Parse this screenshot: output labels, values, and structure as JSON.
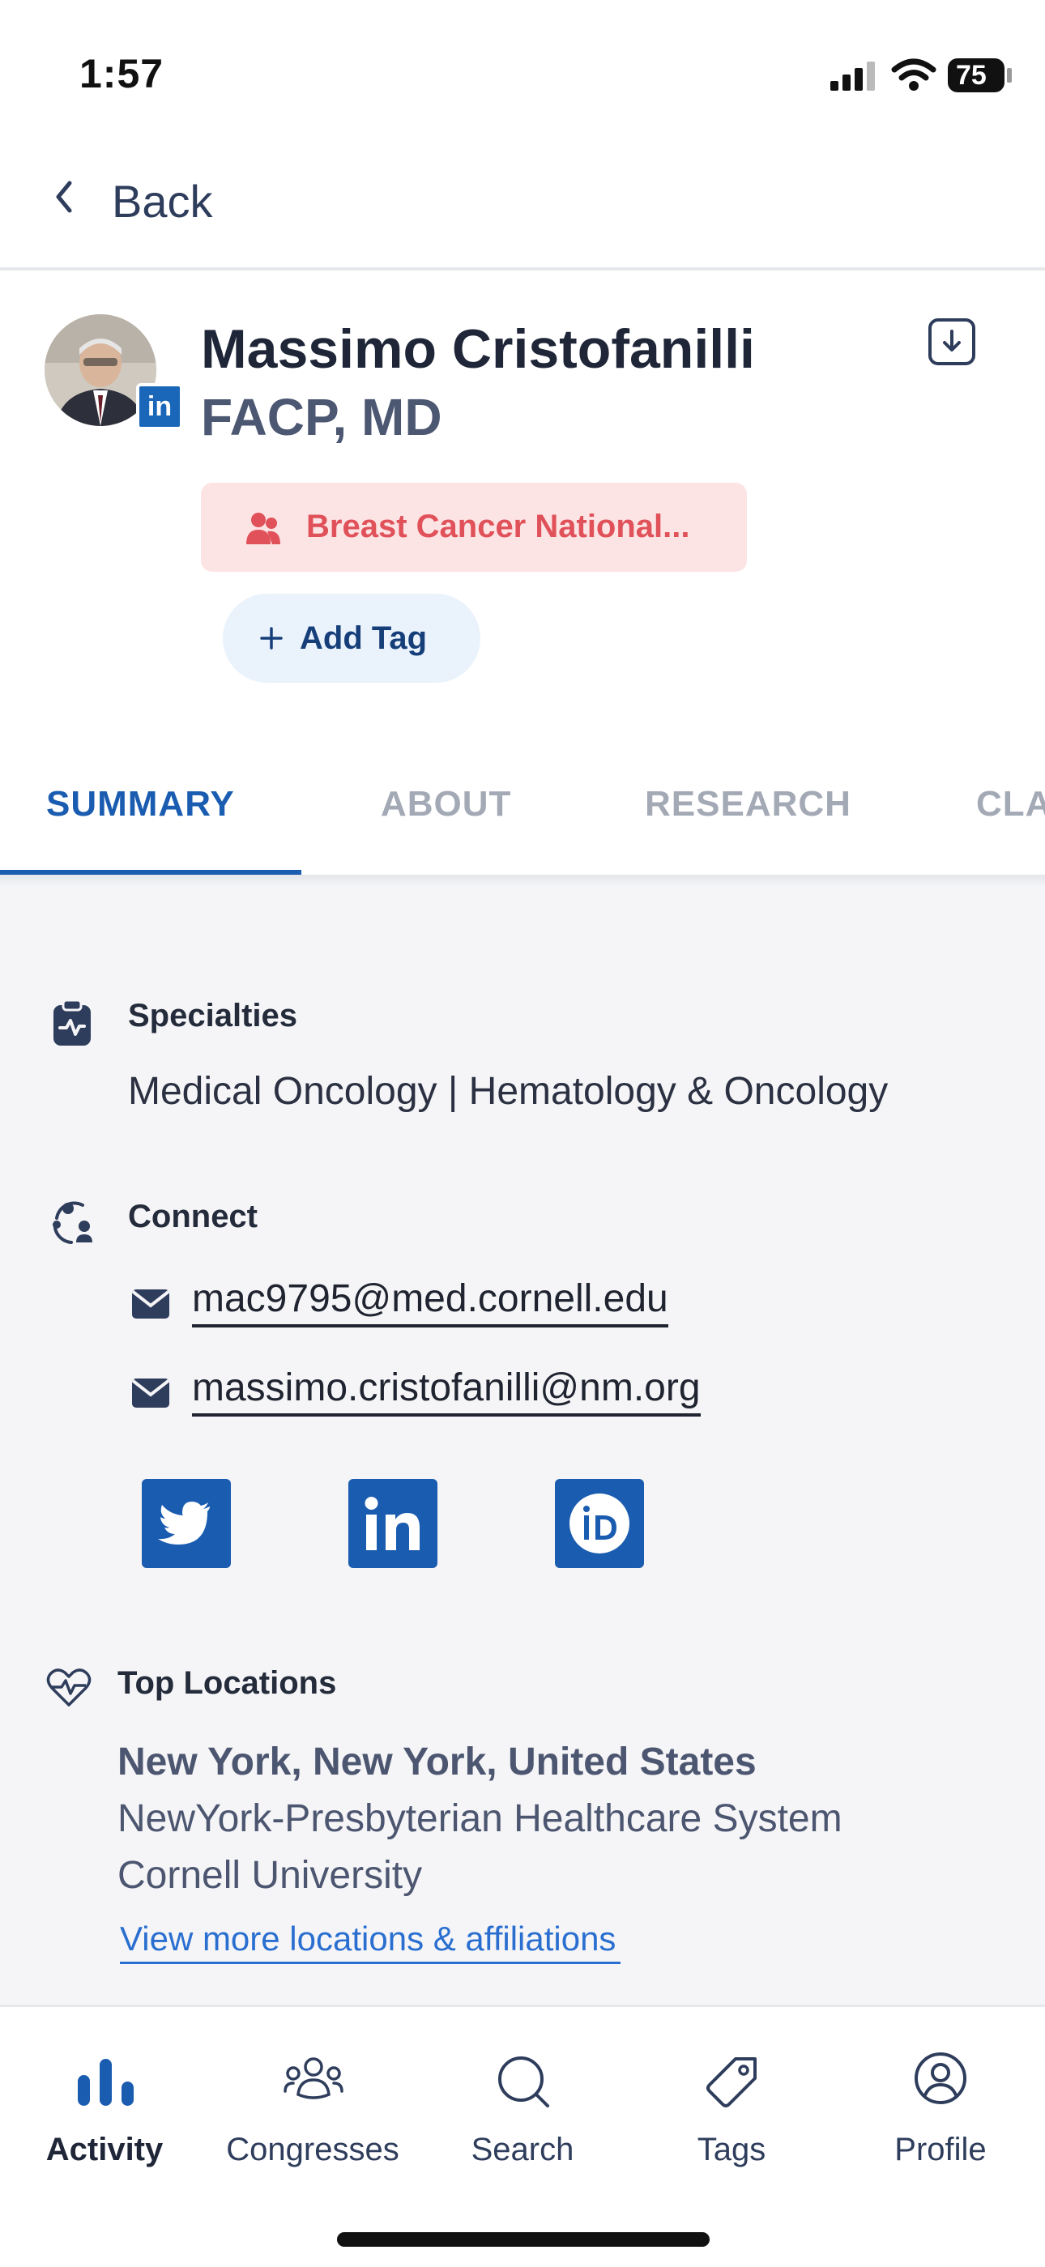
{
  "status_bar": {
    "time": "1:57",
    "battery": "75"
  },
  "header": {
    "back_label": "Back"
  },
  "profile": {
    "name": "Massimo Cristofanilli",
    "credentials": "FACP, MD",
    "org_tag": "Breast Cancer National...",
    "add_tag_label": "Add Tag"
  },
  "tabs": [
    {
      "label": "SUMMARY",
      "active": true
    },
    {
      "label": "ABOUT",
      "active": false
    },
    {
      "label": "RESEARCH",
      "active": false
    },
    {
      "label": "CLA",
      "active": false
    }
  ],
  "specialties": {
    "title": "Specialties",
    "value": "Medical Oncology | Hematology & Oncology"
  },
  "connect": {
    "title": "Connect",
    "emails": [
      "mac9795@med.cornell.edu",
      "massimo.cristofanilli@nm.org"
    ],
    "socials": [
      "twitter-icon",
      "linkedin-icon",
      "orcid-icon"
    ]
  },
  "locations": {
    "title": "Top Locations",
    "primary": "New York, New York, United States",
    "affiliations": [
      "NewYork-Presbyterian Healthcare System",
      "Cornell University"
    ],
    "view_more": "View more locations & affiliations"
  },
  "bottom_nav": [
    {
      "label": "Activity",
      "icon": "activity-icon",
      "active": true
    },
    {
      "label": "Congresses",
      "icon": "congresses-icon",
      "active": false
    },
    {
      "label": "Search",
      "icon": "search-icon",
      "active": false
    },
    {
      "label": "Tags",
      "icon": "tag-icon",
      "active": false
    },
    {
      "label": "Profile",
      "icon": "profile-icon",
      "active": false
    }
  ],
  "colors": {
    "accent": "#1a5cb0",
    "tag_bg": "#fde4e4",
    "tag_text": "#e0515a"
  }
}
